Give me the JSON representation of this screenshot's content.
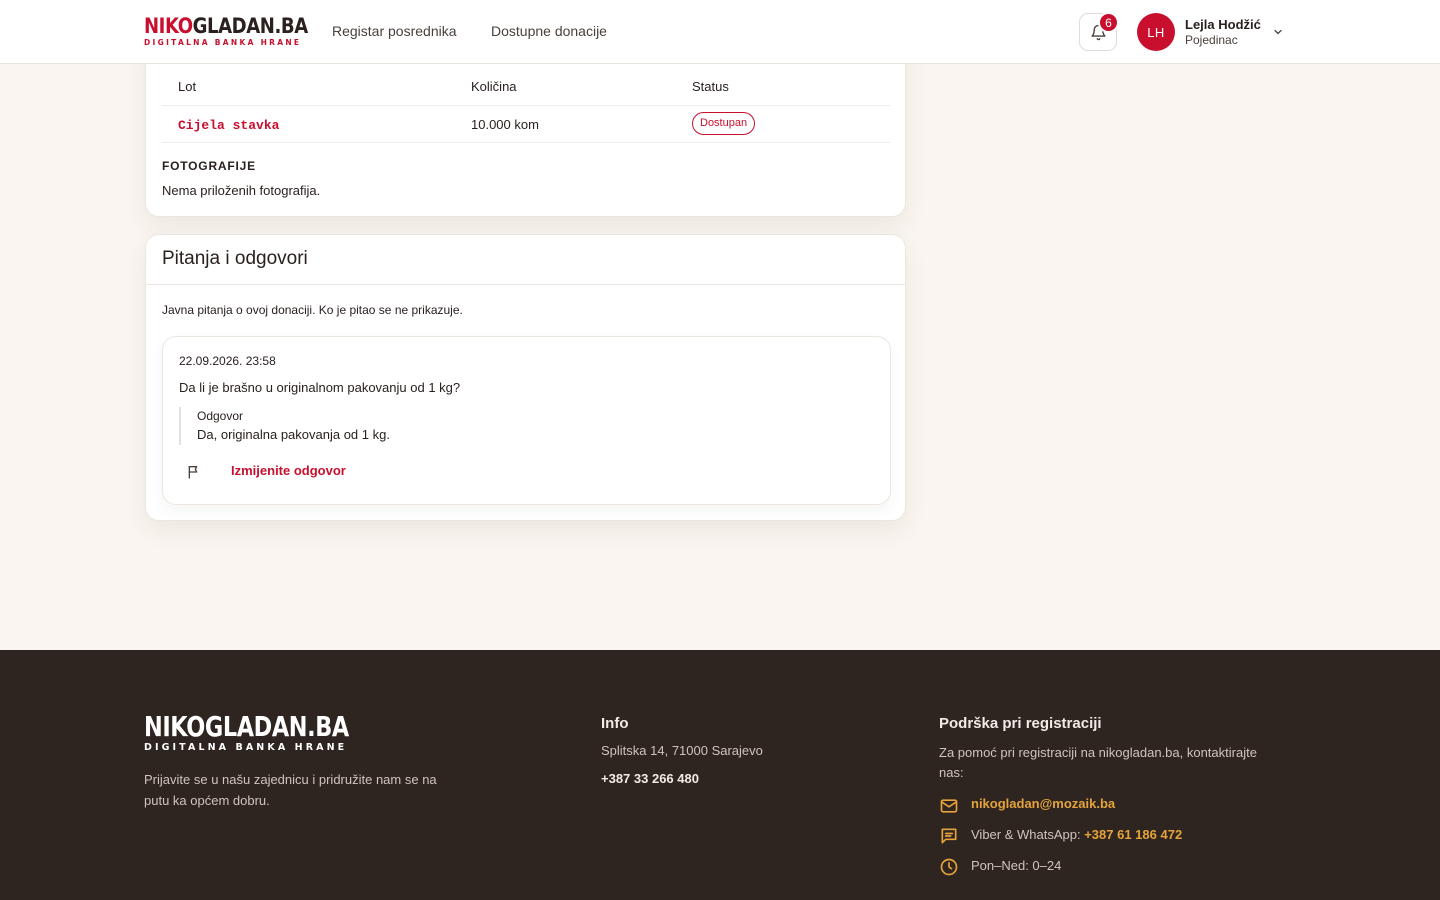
{
  "header": {
    "logo_primary_red": "NIKO",
    "logo_primary_dark": "GLADAN.BA",
    "logo_tagline": "DIGITALNA BANKA HRANE",
    "nav": [
      {
        "label": "Registar posrednika"
      },
      {
        "label": "Dostupne donacije"
      }
    ],
    "notifications_count": "6",
    "user": {
      "initials": "LH",
      "name": "Lejla Hodžić",
      "role": "Pojedinac"
    }
  },
  "lots": {
    "headers": {
      "lot": "Lot",
      "quantity": "Količina",
      "status": "Status"
    },
    "rows": [
      {
        "lot": "Cijela stavka",
        "quantity": "10.000 kom",
        "status": "Dostupan"
      }
    ],
    "photos_label": "FOTOGRAFIJE",
    "no_photos": "Nema priloženih fotografija."
  },
  "qa": {
    "title": "Pitanja i odgovori",
    "description": "Javna pitanja o ovoj donaciji. Ko je pitao se ne prikazuje.",
    "items": [
      {
        "date": "22.09.2026. 23:58",
        "question": "Da li je brašno u originalnom pakovanju od 1 kg?",
        "answer_label": "Odgovor",
        "answer": "Da, originalna pakovanja od 1 kg.",
        "edit_label": "Izmijenite odgovor"
      }
    ]
  },
  "footer": {
    "logo_primary": "NIKOGLADAN.BA",
    "logo_tagline": "DIGITALNA BANKA HRANE",
    "tagline": "Prijavite se u našu zajednicu i pridružite nam se na putu ka općem dobru.",
    "info": {
      "heading": "Info",
      "address": "Splitska 14, 71000 Sarajevo",
      "phone": "+387 33 266 480"
    },
    "support": {
      "heading": "Podrška pri registraciji",
      "text": "Za pomoć pri registraciji na nikogladan.ba, kontaktirajte nas:",
      "email": "nikogladan@mozaik.ba",
      "viber_label": "Viber & WhatsApp: ",
      "viber_number": "+387 61 186 472",
      "hours": "Pon–Ned: 0–24"
    }
  },
  "colors": {
    "brand_red": "#c8102e",
    "accent_gold": "#e5a43b",
    "footer_bg": "#2e2420",
    "page_bg": "#faf5f0"
  },
  "icons": {
    "bell": "bell-icon",
    "chevron": "chevron-down-icon",
    "flag": "flag-icon",
    "mail": "mail-icon",
    "chat": "chat-icon",
    "clock": "clock-icon"
  }
}
